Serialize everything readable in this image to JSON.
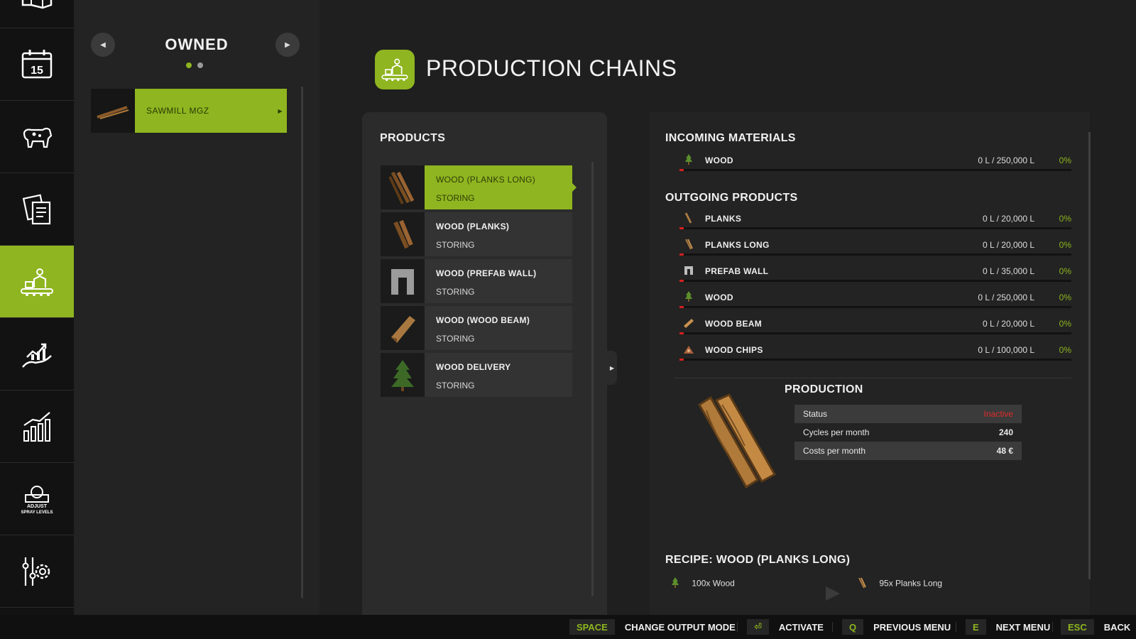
{
  "rail": {
    "items": [
      {
        "icon": "map-icon"
      },
      {
        "icon": "calendar-icon",
        "text": "15"
      },
      {
        "icon": "cow-icon"
      },
      {
        "icon": "contracts-icon"
      },
      {
        "icon": "production-icon",
        "active": true
      },
      {
        "icon": "finance-icon"
      },
      {
        "icon": "statistics-icon"
      },
      {
        "icon": "spray-levels-icon",
        "text_1": "ADJUST",
        "text_2": "SPRAY LEVELS"
      },
      {
        "icon": "settings-icon"
      }
    ]
  },
  "owned": {
    "title": "OWNED",
    "page_dots": 2,
    "active_dot": 0,
    "items": [
      {
        "label": "SAWMILL MGZ"
      }
    ]
  },
  "header": {
    "title": "PRODUCTION CHAINS"
  },
  "products": {
    "title": "PRODUCTS",
    "items": [
      {
        "name": "WOOD (PLANKS LONG)",
        "status": "STORING",
        "selected": true
      },
      {
        "name": "WOOD (PLANKS)",
        "status": "STORING"
      },
      {
        "name": "WOOD (PREFAB WALL)",
        "status": "STORING"
      },
      {
        "name": "WOOD (WOOD BEAM)",
        "status": "STORING"
      },
      {
        "name": "WOOD DELIVERY",
        "status": "STORING"
      }
    ]
  },
  "incoming": {
    "title": "INCOMING MATERIALS",
    "items": [
      {
        "name": "WOOD",
        "value": "0 L / 250,000 L",
        "percent": "0%"
      }
    ]
  },
  "outgoing": {
    "title": "OUTGOING PRODUCTS",
    "items": [
      {
        "name": "PLANKS",
        "value": "0 L / 20,000 L",
        "percent": "0%"
      },
      {
        "name": "PLANKS LONG",
        "value": "0 L / 20,000 L",
        "percent": "0%"
      },
      {
        "name": "PREFAB WALL",
        "value": "0 L / 35,000 L",
        "percent": "0%"
      },
      {
        "name": "WOOD",
        "value": "0 L / 250,000 L",
        "percent": "0%"
      },
      {
        "name": "WOOD BEAM",
        "value": "0 L / 20,000 L",
        "percent": "0%"
      },
      {
        "name": "WOOD CHIPS",
        "value": "0 L / 100,000 L",
        "percent": "0%"
      }
    ]
  },
  "production": {
    "title": "PRODUCTION",
    "rows": [
      {
        "label": "Status",
        "value": "Inactive"
      },
      {
        "label": "Cycles per month",
        "value": "240"
      },
      {
        "label": "Costs per month",
        "value": "48 €"
      }
    ]
  },
  "recipe": {
    "title": "RECIPE: WOOD (PLANKS LONG)",
    "input": "100x Wood",
    "output": "95x Planks Long"
  },
  "bottom": {
    "hints": [
      {
        "key": "SPACE",
        "label": "CHANGE OUTPUT MODE"
      },
      {
        "key": "⏎",
        "label": "ACTIVATE"
      },
      {
        "key": "Q",
        "label": "PREVIOUS MENU"
      },
      {
        "key": "E",
        "label": "NEXT MENU"
      },
      {
        "key": "ESC",
        "label": "BACK"
      }
    ]
  },
  "colors": {
    "accent": "#8fb520",
    "danger": "#e02b2b",
    "background": "#1e1f1e"
  }
}
